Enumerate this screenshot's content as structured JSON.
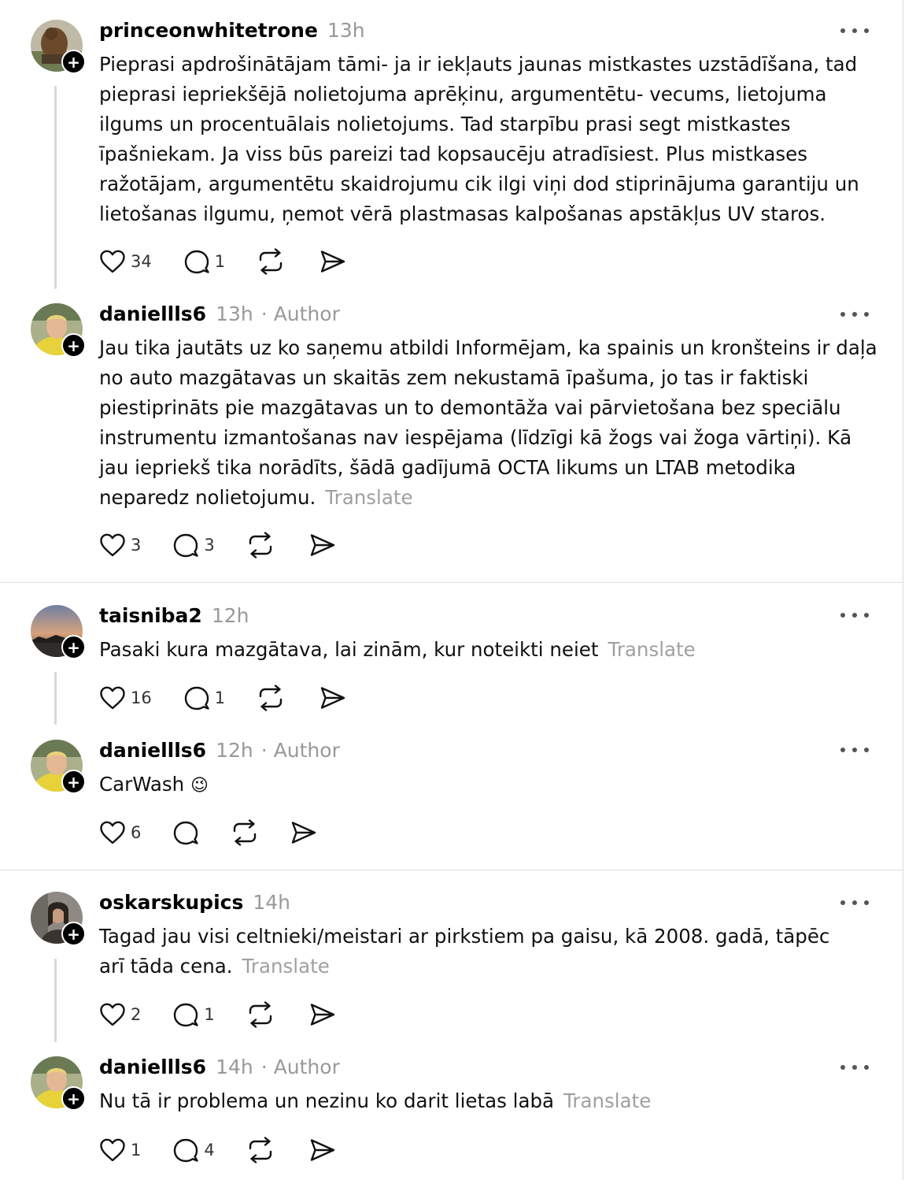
{
  "labels": {
    "author": "Author",
    "separator": "·",
    "translate": "Translate",
    "follow": "+"
  },
  "posts": [
    {
      "username": "princeonwhitetrone",
      "time": "13h",
      "text": "Pieprasi apdrošinātājam tāmi- ja ir iekļauts jaunas mistkastes uzstādīšana, tad pieprasi iepriekšējā nolietojuma aprēķinu, argumentētu- vecums, lietojuma ilgums un procentuālais nolietojums. Tad starpību prasi segt mistkastes īpašniekam. Ja viss būs pareizi tad kopsaucēju atradīsiest. Plus mistkases ražotājam, argumentētu skaidrojumu cik ilgi viņi dod stiprinājuma garantiju un lietošanas ilgumu, ņemot vērā plastmasas kalpošanas apstākļus UV staros.",
      "likes": "34",
      "replies": "1",
      "avatar_icon": "lion-statue-avatar"
    },
    {
      "username": "daniellls6",
      "time": "13h",
      "text": "Jau tika jautāts uz ko saņemu atbildi Informējam, ka spainis un kronšteins ir daļa no auto mazgātavas un skaitās zem nekustamā īpašuma, jo tas ir faktiski piestiprināts pie mazgātavas un to demontāža vai pārvietošana bez speciālu instrumentu izmantošanas nav iespējama (līdzīgi kā žogs vai žoga vārtiņi). Kā jau iepriekš tika norādīts, šādā gadījumā OCTA likums un LTAB metodika neparedz nolietojumu.",
      "likes": "3",
      "replies": "3",
      "avatar_icon": "football-player-avatar"
    },
    {
      "username": "taisniba2",
      "time": "12h",
      "text": "Pasaki kura mazgātava, lai zinām, kur noteikti neiet",
      "likes": "16",
      "replies": "1",
      "avatar_icon": "sunset-landscape-avatar"
    },
    {
      "username": "daniellls6",
      "time": "12h",
      "text": "CarWash",
      "emoji": "😉",
      "likes": "6",
      "replies": "",
      "avatar_icon": "football-player-avatar"
    },
    {
      "username": "oskarskupics",
      "time": "14h",
      "text": "Tagad jau visi celtnieki/meistari ar pirkstiem pa gaisu, kā 2008. gadā, tāpēc arī tāda cena.",
      "likes": "2",
      "replies": "1",
      "avatar_icon": "person-portrait-avatar"
    },
    {
      "username": "daniellls6",
      "time": "14h",
      "text": "Nu tā ir problema un nezinu ko darit lietas labā",
      "likes": "1",
      "replies": "4",
      "avatar_icon": "football-player-avatar"
    }
  ],
  "icons": {
    "like": "heart-icon",
    "reply": "comment-icon",
    "repost": "repost-icon",
    "share": "send-icon",
    "more": "more-options-icon"
  },
  "colors": {
    "text": "#101010",
    "muted": "#999999",
    "translate": "#a0a0a0",
    "badge": "#000000",
    "divider": "#dddddd"
  }
}
